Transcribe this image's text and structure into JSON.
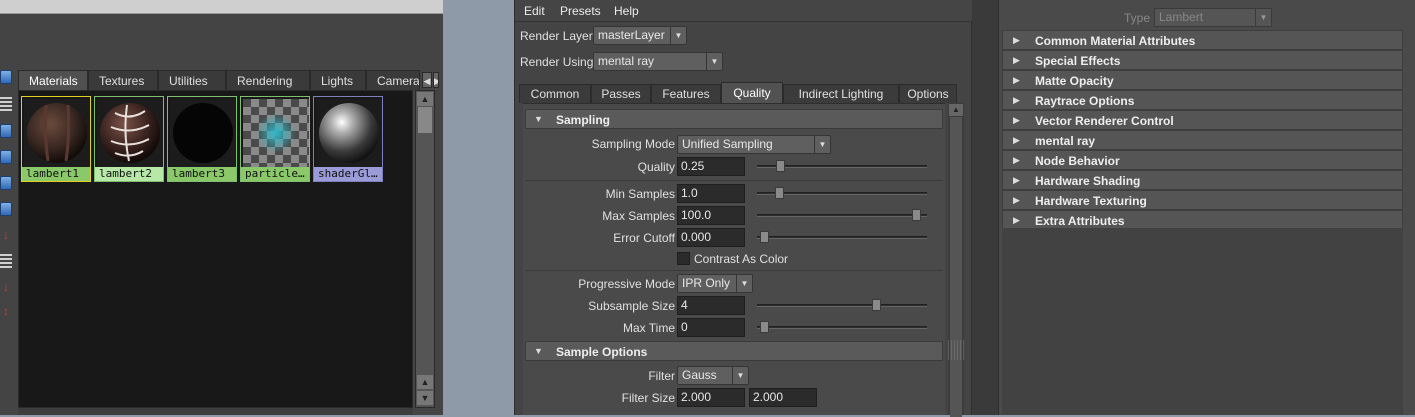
{
  "hypershade": {
    "tabs": [
      "Materials",
      "Textures",
      "Utilities",
      "Rendering",
      "Lights",
      "Camera"
    ],
    "active_tab": "Materials",
    "swatches": [
      {
        "label": "lambert1",
        "label_bg": "#8ac86a",
        "border": "#e0d020"
      },
      {
        "label": "lambert2",
        "label_bg": "#b8e8a8",
        "border": "#7fbf6f"
      },
      {
        "label": "lambert3",
        "label_bg": "#8ac86a",
        "border": "#7fbf6f"
      },
      {
        "label": "particle…",
        "label_bg": "#8ac86a",
        "border": "#7fbf6f"
      },
      {
        "label": "shaderGl…",
        "label_bg": "#9b9bd8",
        "border": "#7f7fbf"
      }
    ]
  },
  "render_settings": {
    "menu": [
      "Edit",
      "Presets",
      "Help"
    ],
    "render_layer_label": "Render Layer",
    "render_layer_value": "masterLayer",
    "render_using_label": "Render Using",
    "render_using_value": "mental ray",
    "tabs": [
      "Common",
      "Passes",
      "Features",
      "Quality",
      "Indirect Lighting",
      "Options"
    ],
    "active_tab": "Quality",
    "sampling": {
      "title": "Sampling",
      "mode_label": "Sampling Mode",
      "mode_value": "Unified Sampling",
      "quality_label": "Quality",
      "quality_value": "0.25",
      "quality_slider": 0.12,
      "min_samples_label": "Min Samples",
      "min_samples_value": "1.0",
      "min_samples_slider": 0.11,
      "max_samples_label": "Max Samples",
      "max_samples_value": "100.0",
      "max_samples_slider": 0.97,
      "error_cutoff_label": "Error Cutoff",
      "error_cutoff_value": "0.000",
      "error_cutoff_slider": 0.02,
      "contrast_label": "Contrast As Color",
      "progressive_label": "Progressive Mode",
      "progressive_value": "IPR Only",
      "subsample_label": "Subsample Size",
      "subsample_value": "4",
      "subsample_slider": 0.72,
      "max_time_label": "Max Time",
      "max_time_value": "0",
      "max_time_slider": 0.02
    },
    "sample_options": {
      "title": "Sample Options",
      "filter_label": "Filter",
      "filter_value": "Gauss",
      "filter_size_label": "Filter Size",
      "filter_size_x": "2.000",
      "filter_size_y": "2.000"
    }
  },
  "attribute_editor": {
    "type_label": "Type",
    "type_value": "Lambert",
    "sections": [
      "Common Material Attributes",
      "Special Effects",
      "Matte Opacity",
      "Raytrace Options",
      "Vector Renderer Control",
      "mental ray",
      "Node Behavior",
      "Hardware Shading",
      "Hardware Texturing",
      "Extra Attributes"
    ]
  }
}
